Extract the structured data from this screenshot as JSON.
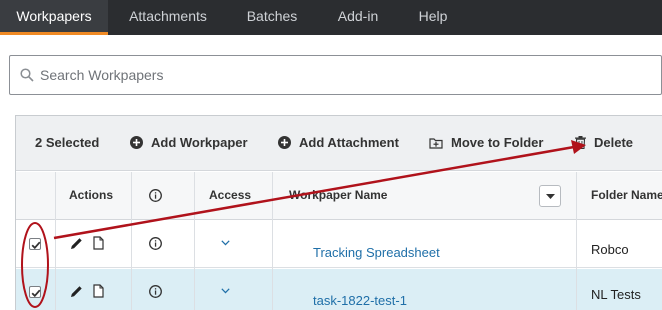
{
  "nav": {
    "tabs": [
      {
        "label": "Workpapers",
        "active": true
      },
      {
        "label": "Attachments",
        "active": false
      },
      {
        "label": "Batches",
        "active": false
      },
      {
        "label": "Add-in",
        "active": false
      },
      {
        "label": "Help",
        "active": false
      }
    ],
    "accent_color": "#f08a24"
  },
  "search": {
    "placeholder": "Search Workpapers",
    "value": ""
  },
  "toolbar": {
    "selected_count": "2 Selected",
    "add_workpaper": "Add Workpaper",
    "add_attachment": "Add Attachment",
    "move_to_folder": "Move to Folder",
    "delete": "Delete"
  },
  "columns": {
    "actions": "Actions",
    "info": "info-icon",
    "access": "Access",
    "workpaper_name": "Workpaper Name",
    "folder_name": "Folder Name"
  },
  "rows": [
    {
      "checked": true,
      "workpaper_name": "Tracking Spreadsheet",
      "folder_name": "Robco",
      "selected": false
    },
    {
      "checked": true,
      "workpaper_name": "task-1822-test-1",
      "folder_name": "NL Tests",
      "selected": true
    }
  ],
  "annotation_color": "#b0121b"
}
